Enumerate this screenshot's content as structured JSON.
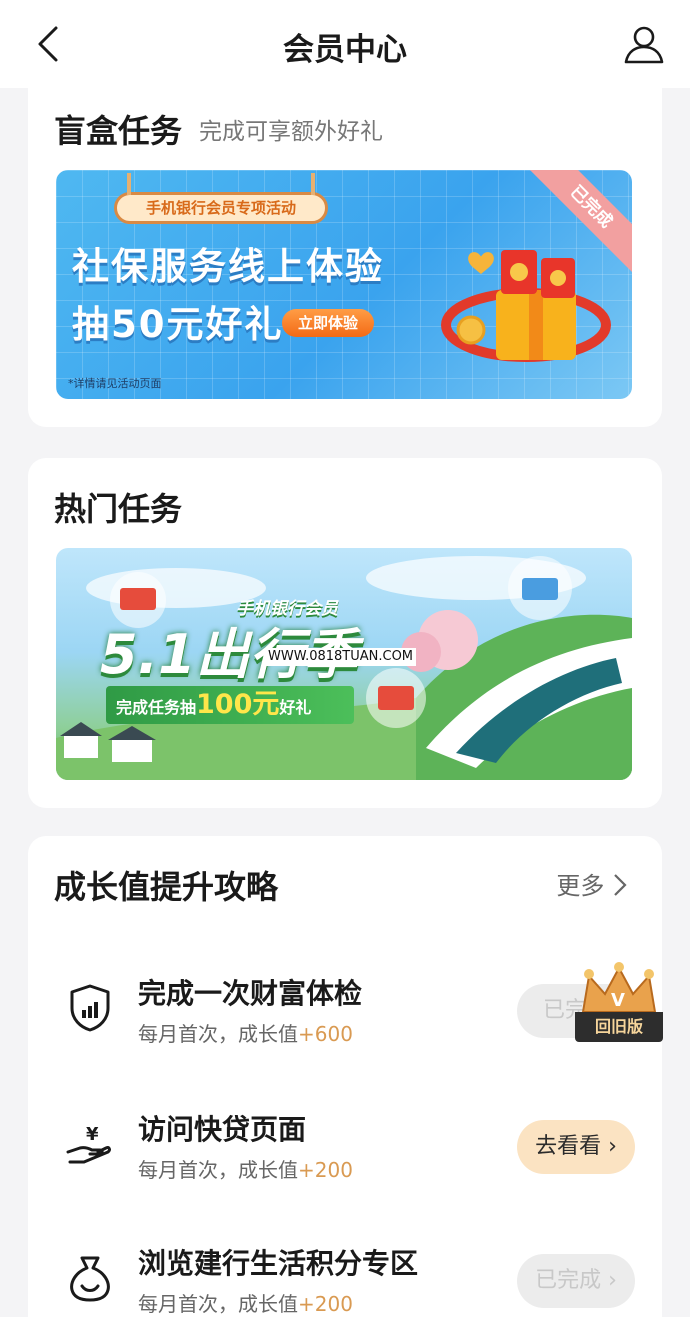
{
  "header": {
    "title": "会员中心"
  },
  "blind_box": {
    "title": "盲盒任务",
    "subtitle": "完成可享额外好礼",
    "banner": {
      "tag": "手机银行会员专项活动",
      "line1": "社保服务线上体验",
      "line2": "抽50元好礼",
      "cta": "立即体验",
      "note": "*详情请见活动页面",
      "ribbon": "已完成"
    }
  },
  "hot": {
    "title": "热门任务",
    "banner": {
      "small_title": "手机银行会员",
      "big_title": "5.1出行季",
      "strip_prefix": "完成任务抽",
      "strip_amount": "100元",
      "strip_suffix": "好礼",
      "watermark": "WWW.0818TUAN.COM"
    }
  },
  "growth": {
    "title": "成长值提升攻略",
    "more": "更多",
    "tasks": [
      {
        "title": "完成一次财富体检",
        "sub": "每月首次，成长值",
        "points": "+600",
        "button": "已完成",
        "icon": "shield-chart-icon"
      },
      {
        "title": "访问快贷页面",
        "sub": "每月首次，成长值",
        "points": "+200",
        "button": "去看看",
        "icon": "hand-coin-icon"
      },
      {
        "title": "浏览建行生活积分专区",
        "sub": "每月首次，成长值",
        "points": "+200",
        "button": "已完成",
        "icon": "money-bag-icon"
      }
    ]
  },
  "floating": {
    "label": "回旧版"
  },
  "colors": {
    "accent_orange": "#d99a52",
    "go_button_bg": "#fbe3c2",
    "done_button_bg": "#ececec"
  }
}
